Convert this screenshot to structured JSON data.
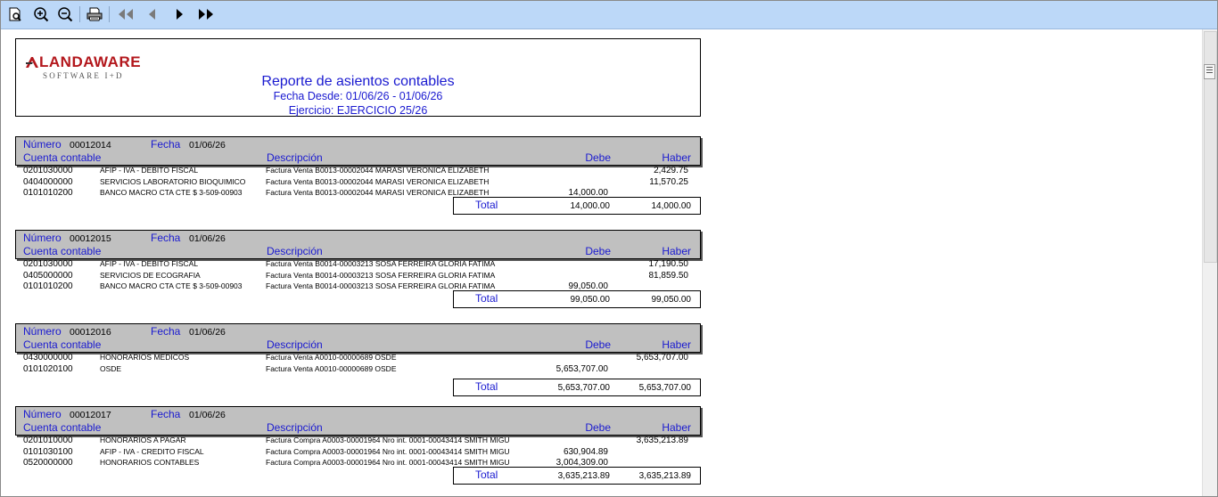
{
  "report": {
    "logo_main": "LANDAWARE",
    "logo_sub": "SOFTWARE I+D",
    "title": "Reporte de asientos contables",
    "subtitle1": "Fecha Desde: 01/06/26 - 01/06/26",
    "subtitle2": "Ejercicio: EJERCICIO 25/26"
  },
  "labels": {
    "numero": "Número",
    "fecha": "Fecha",
    "cuenta": "Cuenta contable",
    "descripcion": "Descripción",
    "debe": "Debe",
    "haber": "Haber",
    "total": "Total"
  },
  "entries": [
    {
      "numero": "00012014",
      "fecha": "01/06/26",
      "rows": [
        {
          "code": "0201030000",
          "account": "AFIP - IVA - DEBITO FISCAL",
          "desc": "Factura Venta B0013-00002044 MARASI VERONICA ELIZABETH",
          "debe": "",
          "haber": "2,429.75"
        },
        {
          "code": "0404000000",
          "account": "SERVICIOS LABORATORIO BIOQUIMICO",
          "desc": "Factura Venta B0013-00002044 MARASI VERONICA ELIZABETH",
          "debe": "",
          "haber": "11,570.25"
        },
        {
          "code": "0101010200",
          "account": "BANCO MACRO CTA CTE $ 3-509-00903",
          "desc": "Factura Venta B0013-00002044 MARASI VERONICA ELIZABETH",
          "debe": "14,000.00",
          "haber": ""
        }
      ],
      "total_debe": "14,000.00",
      "total_haber": "14,000.00"
    },
    {
      "numero": "00012015",
      "fecha": "01/06/26",
      "rows": [
        {
          "code": "0201030000",
          "account": "AFIP - IVA - DEBITO FISCAL",
          "desc": "Factura Venta B0014-00003213 SOSA FERREIRA GLORIA FATIMA",
          "debe": "",
          "haber": "17,190.50"
        },
        {
          "code": "0405000000",
          "account": "SERVICIOS DE ECOGRAFIA",
          "desc": "Factura Venta B0014-00003213 SOSA FERREIRA GLORIA FATIMA",
          "debe": "",
          "haber": "81,859.50"
        },
        {
          "code": "0101010200",
          "account": "BANCO MACRO CTA CTE $ 3-509-00903",
          "desc": "Factura Venta B0014-00003213 SOSA FERREIRA GLORIA FATIMA",
          "debe": "99,050.00",
          "haber": ""
        }
      ],
      "total_debe": "99,050.00",
      "total_haber": "99,050.00"
    },
    {
      "numero": "00012016",
      "fecha": "01/06/26",
      "rows": [
        {
          "code": "0430000000",
          "account": "HONORARIOS MEDICOS",
          "desc": "Factura Venta A0010-00000689 OSDE",
          "debe": "",
          "haber": "5,653,707.00"
        },
        {
          "code": "0101020100",
          "account": "OSDE",
          "desc": "Factura Venta A0010-00000689 OSDE",
          "debe": "5,653,707.00",
          "haber": ""
        }
      ],
      "total_debe": "5,653,707.00",
      "total_haber": "5,653,707.00"
    },
    {
      "numero": "00012017",
      "fecha": "01/06/26",
      "rows": [
        {
          "code": "0201010000",
          "account": "HONORARIOS A PAGAR",
          "desc": "Factura Compra A0003-00001964 Nro int. 0001-00043414 SMITH MIGU",
          "debe": "",
          "haber": "3,635,213.89"
        },
        {
          "code": "0101030100",
          "account": "AFIP - IVA - CREDITO FISCAL",
          "desc": "Factura Compra A0003-00001964 Nro int. 0001-00043414 SMITH MIGU",
          "debe": "630,904.89",
          "haber": ""
        },
        {
          "code": "0520000000",
          "account": "HONORARIOS CONTABLES",
          "desc": "Factura Compra A0003-00001964 Nro int. 0001-00043414 SMITH MIGU",
          "debe": "3,004,309.00",
          "haber": ""
        }
      ],
      "total_debe": "3,635,213.89",
      "total_haber": "3,635,213.89"
    }
  ]
}
